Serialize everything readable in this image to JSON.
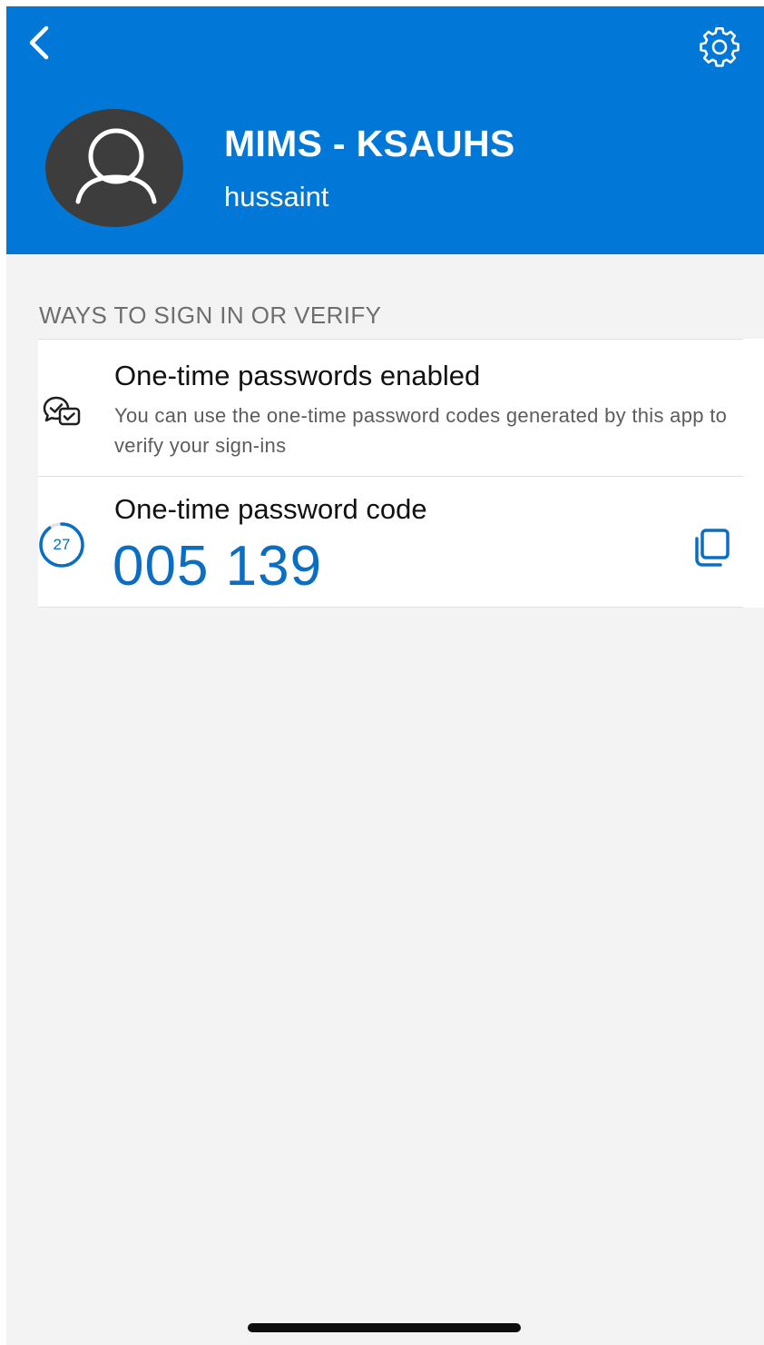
{
  "header": {
    "back_icon": "chevron-left-icon",
    "settings_icon": "gear-icon",
    "avatar_icon": "person-icon",
    "account_name": "MIMS - KSAUHS",
    "username": "hussaint",
    "colors": {
      "header_background": "#0177d7",
      "header_text": "#ffffff"
    }
  },
  "section": {
    "title": "WAYS TO SIGN IN OR VERIFY"
  },
  "otp_enabled": {
    "icon": "verified-chat-icon",
    "title": "One-time passwords enabled",
    "description": "You can use the one-time password codes generated by this app to verify your sign-ins"
  },
  "otp_code": {
    "title": "One-time password code",
    "timer_seconds": "27",
    "timer_remaining_fraction": 0.9,
    "code": "005 139",
    "copy_icon": "copy-icon",
    "colors": {
      "code": "#0b6ec2"
    }
  }
}
